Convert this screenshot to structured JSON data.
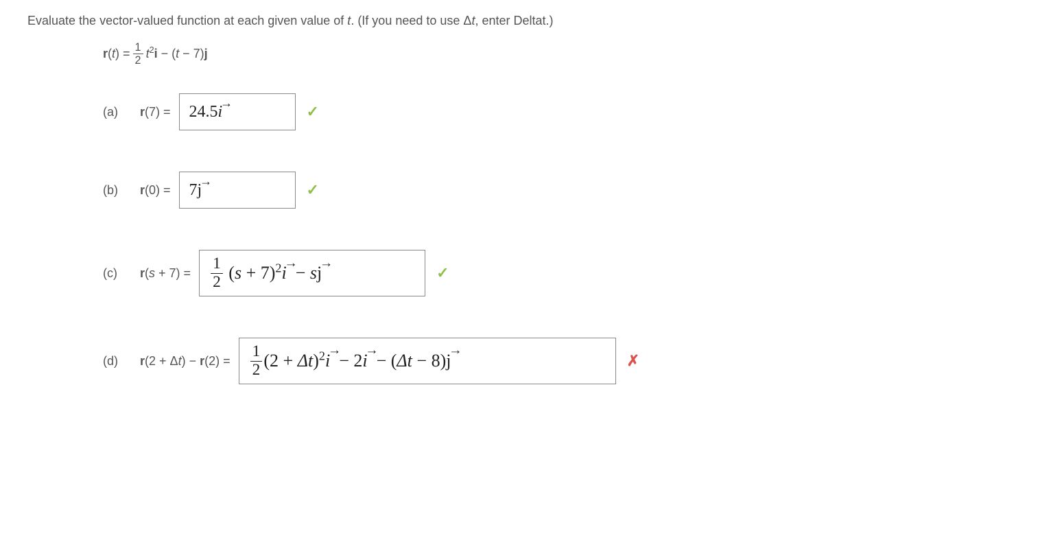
{
  "question": {
    "text_before_t": "Evaluate the vector-valued function at each given value of ",
    "var_t": "t",
    "text_after_t": ". (If you need to use Δ",
    "var_t2": "t",
    "text_tail": ", enter Deltat.)"
  },
  "function_def": {
    "lhs_r": "r",
    "lhs_t": "t",
    "frac_num": "1",
    "frac_den": "2",
    "t_var": "t",
    "i": "i",
    "j": "j",
    "seven": "7"
  },
  "parts": {
    "a": {
      "label": "(a)",
      "prefix_r": "r",
      "prefix_arg": "7",
      "answer_text": "24.5",
      "answer_vec": "i"
    },
    "b": {
      "label": "(b)",
      "prefix_r": "r",
      "prefix_arg": "0",
      "answer_text": "7",
      "answer_vec": "j"
    },
    "c": {
      "label": "(c)",
      "prefix_r": "r",
      "prefix_arg_s": "s",
      "prefix_arg_plus": " + 7",
      "frac_num": "1",
      "frac_den": "2",
      "s": "s",
      "seven": "7",
      "i": "i",
      "s2": "s",
      "j": "j"
    },
    "d": {
      "label": "(d)",
      "prefix_r1": "r",
      "prefix_arg1": "2 + Δ",
      "prefix_t": "t",
      "prefix_r2": "r",
      "prefix_arg2": "2",
      "frac_num": "1",
      "frac_den": "2",
      "two": "2",
      "delta_t": "Δt",
      "i": "i",
      "two_i": "2",
      "i2": "i",
      "delta_t2": "Δt",
      "eight": "8",
      "j": "j"
    }
  }
}
